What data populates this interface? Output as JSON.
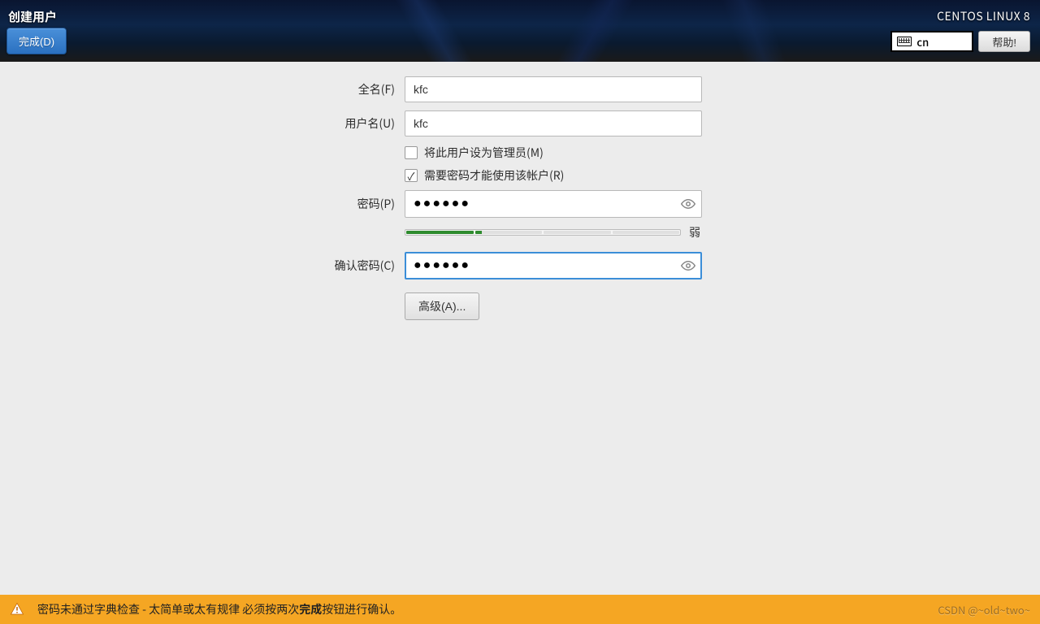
{
  "header": {
    "title": "创建用户",
    "done_label": "完成(D)",
    "os_label": "CENTOS LINUX 8",
    "keyboard_layout": "cn",
    "help_label": "帮助!"
  },
  "form": {
    "fullname_label": "全名(F)",
    "fullname_value": "kfc",
    "username_label": "用户名(U)",
    "username_value": "kfc",
    "admin_checkbox_label": "将此用户设为管理员(M)",
    "admin_checked": false,
    "require_pw_label": "需要密码才能使用该帐户(R)",
    "require_pw_checked": true,
    "password_label": "密码(P)",
    "password_value": "●●●●●●",
    "confirm_label": "确认密码(C)",
    "confirm_value": "●●●●●●",
    "strength_label": "弱",
    "advanced_label": "高级(A)..."
  },
  "footer": {
    "msg_pre": "密码未通过字典检查 - 太简单或太有规律 必须按两次",
    "msg_bold": "完成",
    "msg_post": "按钮进行确认。",
    "watermark": "CSDN @~old~two~"
  }
}
